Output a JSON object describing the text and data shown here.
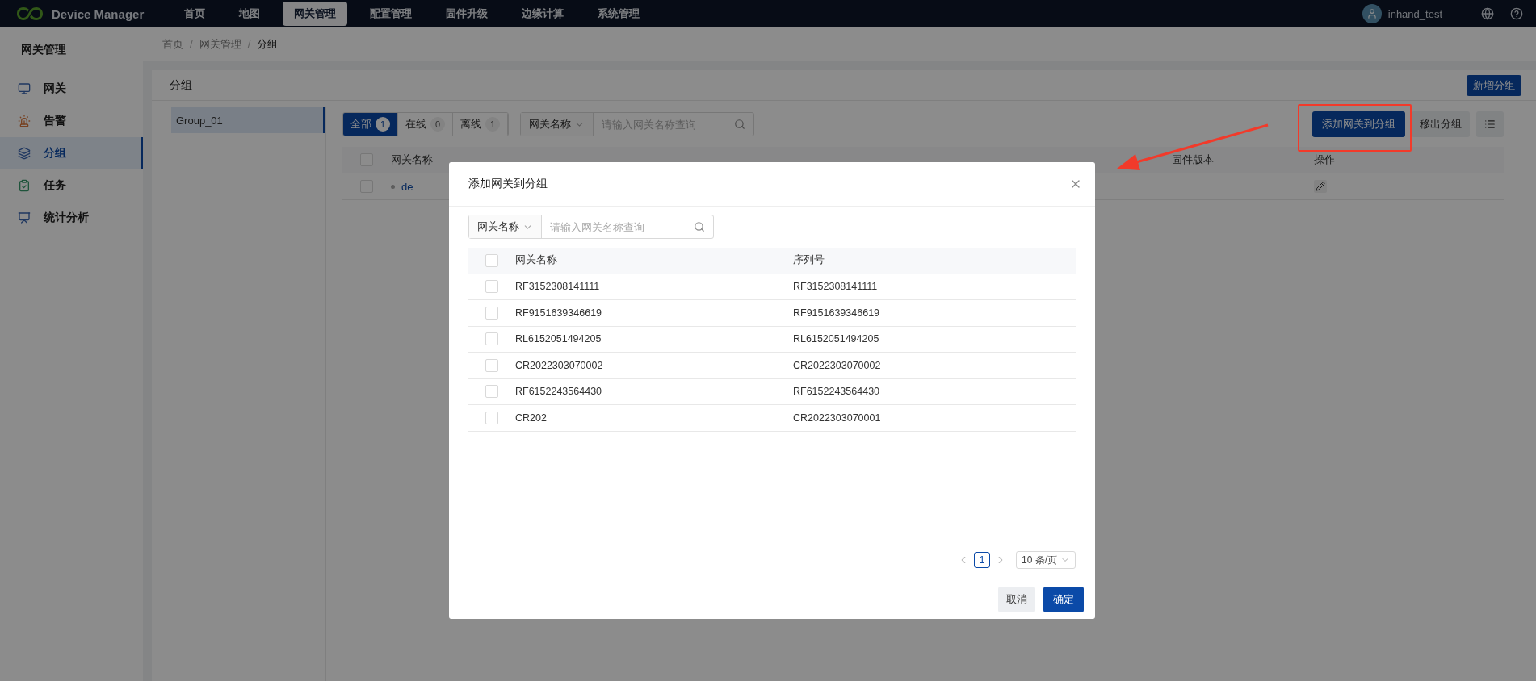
{
  "topbar": {
    "brand": "Device Manager",
    "nav": [
      {
        "label": "首页",
        "selected": false
      },
      {
        "label": "地图",
        "selected": false
      },
      {
        "label": "网关管理",
        "selected": true
      },
      {
        "label": "配置管理",
        "selected": false
      },
      {
        "label": "固件升级",
        "selected": false
      },
      {
        "label": "边缘计算",
        "selected": false
      },
      {
        "label": "系统管理",
        "selected": false
      }
    ],
    "user": "inhand_test"
  },
  "sidebar": {
    "title": "网关管理",
    "items": [
      {
        "label": "网关",
        "selected": false
      },
      {
        "label": "告警",
        "selected": false
      },
      {
        "label": "分组",
        "selected": true
      },
      {
        "label": "任务",
        "selected": false
      },
      {
        "label": "统计分析",
        "selected": false
      }
    ]
  },
  "breadcrumb": [
    "首页",
    "网关管理",
    "分组"
  ],
  "breadcrumb_separator": "/",
  "card": {
    "title": "分组",
    "new_button": "新增分组"
  },
  "groups": [
    {
      "label": "Group_01",
      "selected": true
    }
  ],
  "filters": [
    {
      "label": "全部",
      "count": "1",
      "selected": true
    },
    {
      "label": "在线",
      "count": "0",
      "selected": false
    },
    {
      "label": "离线",
      "count": "1",
      "selected": false
    }
  ],
  "search": {
    "field": "网关名称",
    "placeholder": "请输入网关名称查询"
  },
  "actions": {
    "add": "添加网关到分组",
    "remove": "移出分组"
  },
  "table": {
    "all_checked": false,
    "columns": [
      "网关名称",
      "固件版本",
      "操作"
    ],
    "rows": [
      {
        "name": "de",
        "checked": false
      }
    ]
  },
  "dialog": {
    "title": "添加网关到分组",
    "search": {
      "field": "网关名称",
      "placeholder": "请输入网关名称查询"
    },
    "all_checked": false,
    "columns": [
      "网关名称",
      "序列号"
    ],
    "rows": [
      {
        "name": "RF3152308141111",
        "serial": "RF3152308141111",
        "checked": false
      },
      {
        "name": "RF9151639346619",
        "serial": "RF9151639346619",
        "checked": false
      },
      {
        "name": "RL6152051494205",
        "serial": "RL6152051494205",
        "checked": false
      },
      {
        "name": "CR2022303070002",
        "serial": "CR2022303070002",
        "checked": false
      },
      {
        "name": "RF6152243564430",
        "serial": "RF6152243564430",
        "checked": false
      },
      {
        "name": "CR202",
        "serial": "CR2022303070001",
        "checked": false
      }
    ],
    "pagination": {
      "pages": [
        {
          "label": "1",
          "selected": true
        }
      ],
      "page_size": "10 条/页"
    },
    "cancel": "取消",
    "ok": "确定"
  }
}
